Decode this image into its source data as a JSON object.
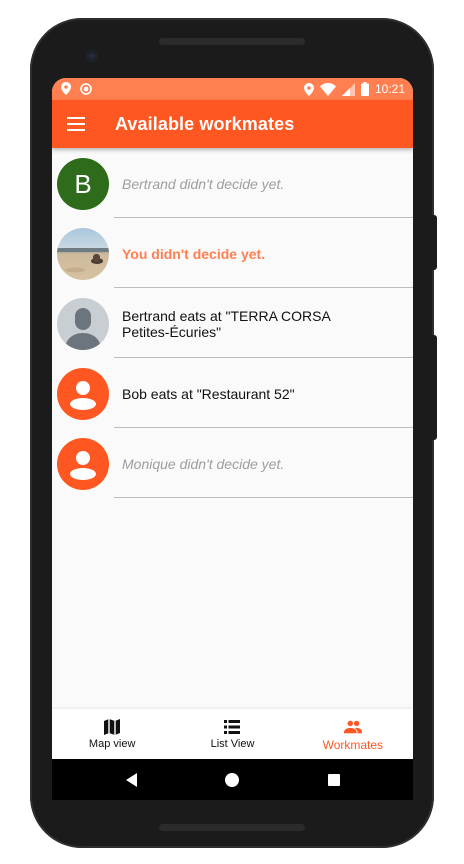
{
  "status_bar": {
    "time": "10:21",
    "icons_left": [
      "location-icon",
      "circle-status-icon"
    ],
    "icons_right": [
      "location-icon",
      "wifi-icon",
      "signal-icon",
      "battery-icon"
    ]
  },
  "app_bar": {
    "title": "Available workmates",
    "menu_icon": "hamburger-menu-icon"
  },
  "workmates": [
    {
      "avatar_type": "letter",
      "avatar_letter": "B",
      "text_line1": "Bertrand didn't decide yet.",
      "text_line2": "",
      "style": "pending"
    },
    {
      "avatar_type": "photo",
      "avatar_letter": "",
      "text_line1": "You didn't decide yet.",
      "text_line2": "",
      "style": "self"
    },
    {
      "avatar_type": "silhouette-grey",
      "avatar_letter": "",
      "text_line1": "Bertrand eats at \"TERRA CORSA",
      "text_line2": "Petites-Écuries\"",
      "style": "decided"
    },
    {
      "avatar_type": "silhouette-orange",
      "avatar_letter": "",
      "text_line1": "Bob eats at \"Restaurant 52\"",
      "text_line2": "",
      "style": "decided"
    },
    {
      "avatar_type": "silhouette-orange",
      "avatar_letter": "",
      "text_line1": "Monique didn't decide yet.",
      "text_line2": "",
      "style": "pending"
    }
  ],
  "bottom_nav": {
    "items": [
      {
        "label": "Map view",
        "icon": "map-icon",
        "active": false
      },
      {
        "label": "List View",
        "icon": "list-icon",
        "active": false
      },
      {
        "label": "Workmates",
        "icon": "people-icon",
        "active": true
      }
    ]
  },
  "system_nav": {
    "icons": [
      "back-icon",
      "home-icon",
      "recents-icon"
    ]
  },
  "colors": {
    "primary": "#ff5722",
    "status_bar": "#ff7f50",
    "self_text": "#ff7f50",
    "pending_text": "#9e9e9e",
    "letter_avatar": "#2e6b1a"
  }
}
